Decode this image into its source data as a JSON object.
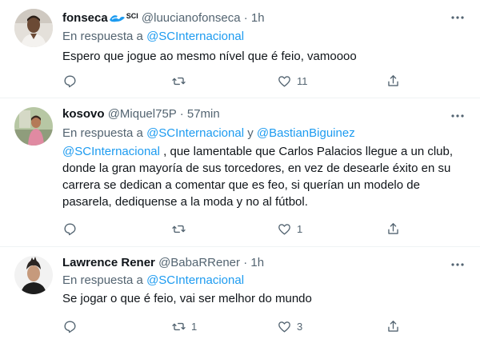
{
  "tweets": [
    {
      "name": "fonseca",
      "badge": "SCI",
      "handle": "@luucianofonseca",
      "dot": "·",
      "time": "1h",
      "reply_prefix": "En respuesta a",
      "reply_mention1": "@SCInternacional",
      "body": "Espero que jogue ao mesmo nível que é feio, vamoooo",
      "likes": "11"
    },
    {
      "name": "kosovo",
      "handle": "@Miquel75P",
      "dot": "·",
      "time": "57min",
      "reply_prefix": "En respuesta a",
      "reply_mention1": "@SCInternacional",
      "reply_joiner": "y",
      "reply_mention2": "@BastianBiguinez",
      "body_mention": "@SCInternacional",
      "body_line1": " , que lamentable que Carlos Palacios llegue a un club,",
      "body_line2": "donde la gran mayoría de sus torcedores, en vez de desearle éxito en su",
      "body_line3": "carrera se dedican a comentar que es feo, si querían un modelo de",
      "body_line4": "pasarela, dediquense a la moda y no al fútbol.",
      "likes": "1"
    },
    {
      "name": "Lawrence Rener",
      "handle": "@BabaRRener",
      "dot": "·",
      "time": "1h",
      "reply_prefix": "En respuesta a",
      "reply_mention1": "@SCInternacional",
      "body": "Se jogar o que é feio, vai ser melhor do mundo",
      "retweets": "1",
      "likes": "3"
    }
  ],
  "colors": {
    "accent": "#1d9bf0",
    "muted": "#536471",
    "divider": "#eff3f4"
  },
  "icons": [
    "reply-icon",
    "retweet-icon",
    "like-icon",
    "share-icon",
    "more-icon",
    "sci-logo-icon"
  ]
}
